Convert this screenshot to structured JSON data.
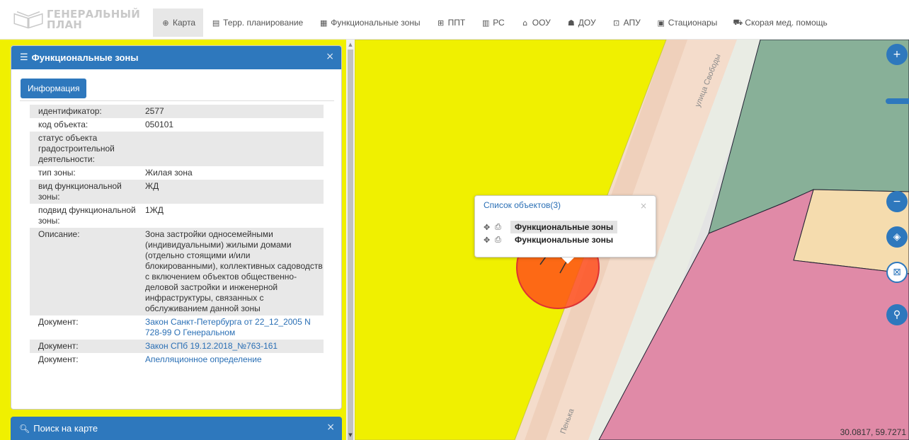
{
  "logo": {
    "line1": "ГЕНЕРАЛЬНЫЙ",
    "line2": "ПЛАН"
  },
  "nav": [
    {
      "icon": "globe-icon",
      "glyph": "⊕",
      "label": "Карта",
      "active": true
    },
    {
      "icon": "document-icon",
      "glyph": "▤",
      "label": "Терр. планирование"
    },
    {
      "icon": "list-icon",
      "glyph": "▦",
      "label": "Функциональные зоны"
    },
    {
      "icon": "grid-icon",
      "glyph": "⊞",
      "label": "ППТ"
    },
    {
      "icon": "building-icon",
      "glyph": "▥",
      "label": "РС"
    },
    {
      "icon": "school-icon",
      "glyph": "⌂",
      "label": "ООУ"
    },
    {
      "icon": "kindergarten-icon",
      "glyph": "☗",
      "label": "ДОУ"
    },
    {
      "icon": "apu-icon",
      "glyph": "⊡",
      "label": "АПУ"
    },
    {
      "icon": "hospital-icon",
      "glyph": "▣",
      "label": "Стационары"
    },
    {
      "icon": "ambulance-icon",
      "glyph": "⛟",
      "label": "Скорая мед. помощь"
    }
  ],
  "panel": {
    "title": "Функциональные зоны",
    "close": "×",
    "info_button": "Информация",
    "rows": [
      {
        "key": "идентификатор:",
        "value": "2577"
      },
      {
        "key": "код объекта:",
        "value": "050101"
      },
      {
        "key": "статус объекта градостроительной деятельности:",
        "value": ""
      },
      {
        "key": "тип зоны:",
        "value": "Жилая зона"
      },
      {
        "key": "вид функциональной зоны:",
        "value": "ЖД"
      },
      {
        "key": "подвид функциональной зоны:",
        "value": "1ЖД"
      },
      {
        "key": "Описание:",
        "value": "Зона застройки односемейными (индивидуальными) жилыми домами (отдельно стоящими и/или блокированными), коллективных садоводств с включением объектов общественно-деловой застройки и инженерной инфраструктуры, связанных с обслуживанием данной зоны"
      },
      {
        "key": "Документ:",
        "value": "Закон Санкт-Петербурга от 22_12_2005 N 728-99 О Генеральном",
        "link": true
      },
      {
        "key": "Документ:",
        "value": "Закон СПб 19.12.2018_№763-161",
        "link": true
      },
      {
        "key": "Документ:",
        "value": "Апелляционное определение",
        "link": true
      }
    ]
  },
  "search_panel": {
    "title": "Поиск на карте",
    "close": "×"
  },
  "popup": {
    "title": "Список объектов(3)",
    "close": "×",
    "items": [
      {
        "label": "Функциональные зоны",
        "selected": true
      },
      {
        "label": "Функциональные зоны",
        "selected": false
      }
    ]
  },
  "map": {
    "street_label": "улица Свободы",
    "street_label_2": "Пенька",
    "coords": "30.0817, 59.7271"
  },
  "colors": {
    "accent": "#2e78bd",
    "zone_residential": "#f0f000",
    "zone_pink": "#e08aa7",
    "zone_green": "#88b098",
    "zone_beige": "#f5dcae",
    "selection": "#ff4a1a"
  }
}
